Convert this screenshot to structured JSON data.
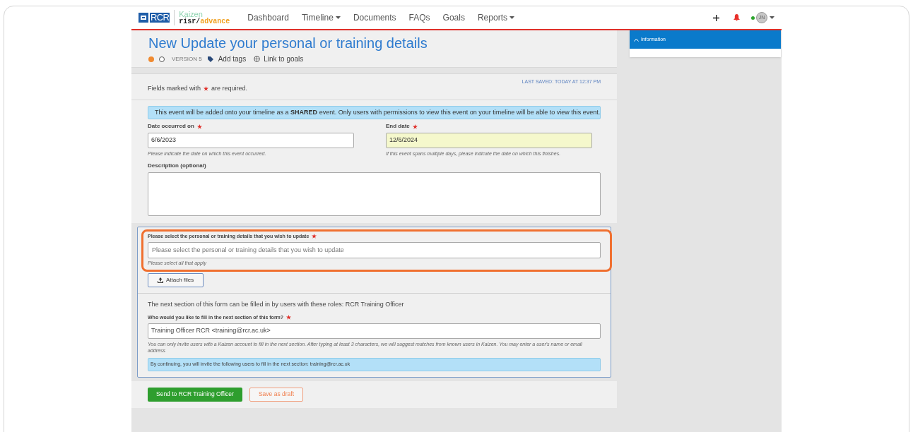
{
  "navbar": {
    "logo_text": "RCR",
    "brand_top": "Kaizen",
    "brand_prefix": "risr/",
    "brand_suffix": "advance",
    "items": [
      {
        "label": "Dashboard",
        "dropdown": false
      },
      {
        "label": "Timeline",
        "dropdown": true
      },
      {
        "label": "Documents",
        "dropdown": false
      },
      {
        "label": "FAQs",
        "dropdown": false
      },
      {
        "label": "Goals",
        "dropdown": false
      },
      {
        "label": "Reports",
        "dropdown": true
      }
    ],
    "user": {
      "initials": "JN",
      "online": true
    }
  },
  "header": {
    "title": "New Update your personal or training details",
    "progress": [
      {
        "complete": true
      },
      {
        "complete": false
      }
    ],
    "version": "VERSION 5",
    "add_tags": "Add tags",
    "link_goals": "Link to goals"
  },
  "form": {
    "required_note": "Fields marked with",
    "required_note_end": "are required.",
    "last_saved": "LAST SAVED: TODAY AT 12:37 PM",
    "info": "This event will be added onto your timeline as a **SHARED** event. Only users with permissions to view this event on your timeline will be able to view this event.",
    "dates": [
      {
        "label": "Date occurred on",
        "required": true,
        "value": "6/6/2023",
        "highlighted": false,
        "hint": "Please indicate the date on which this event occurred."
      },
      {
        "label": "End date",
        "required": true,
        "value": "12/6/2024",
        "highlighted": true,
        "hint": "If this event spans multiple days, please indicate the date on which this finishes."
      }
    ],
    "description_label": "Description (optional)",
    "select": {
      "label": "Please select the personal or training details that you wish to update",
      "required": true,
      "placeholder": "Please select the personal or training details that you wish to update",
      "hint": "Please select all that apply",
      "emphasized": true
    },
    "attach": "Attach files",
    "next_roles": "The next section of this form can be filled in by users with these roles: RCR Training Officer",
    "invite": {
      "label": "Who would you like to fill in the next section of this form?",
      "required": true,
      "value": "Training Officer RCR <training@rcr.ac.uk>",
      "hint": "You can only invite users with a Kaizen account to fill in the next section. After typing at least 3 characters, we will suggest matches from known users in Kaizen. You may enter a user's name or email address"
    },
    "invite_notice": "By continuing, you will invite the following users to fill in the next section: training@rcr.ac.uk"
  },
  "actions": {
    "send": "Send to RCR Training Officer",
    "draft": "Save as draft"
  },
  "sidebar": {
    "panel_title": "Information",
    "expanded": true
  }
}
